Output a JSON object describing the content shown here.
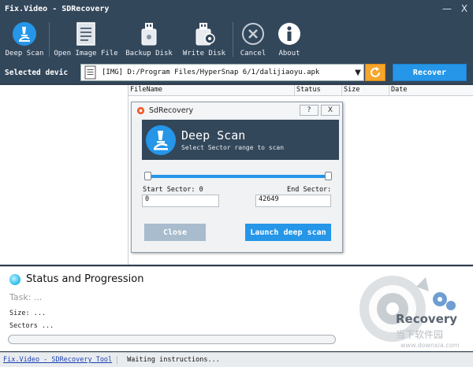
{
  "window": {
    "title": "Fix.Video - SDRecovery",
    "minimize": "—",
    "close": "X"
  },
  "toolbar": {
    "items": [
      {
        "label": "Deep Scan",
        "icon": "microscope-icon"
      },
      {
        "label": "Open Image File",
        "icon": "document-icon"
      },
      {
        "label": "Backup Disk",
        "icon": "usb-drive-icon"
      },
      {
        "label": "Write Disk",
        "icon": "usb-write-icon"
      },
      {
        "label": "Cancel",
        "icon": "cancel-circle-icon"
      },
      {
        "label": "About",
        "icon": "info-icon"
      }
    ]
  },
  "device": {
    "label": "Selected devic",
    "path": "[IMG] D:/Program Files/HyperSnap 6/1/dalijiaoyu.apk",
    "dropdown_glyph": "▼",
    "recover_label": "Recover"
  },
  "file_table": {
    "columns": [
      "FileName",
      "Status",
      "Size",
      "Date"
    ]
  },
  "dialog": {
    "title": "SdRecovery",
    "help": "?",
    "close": "X",
    "heading": "Deep Scan",
    "subheading": "Select Sector range to scan",
    "start_label": "Start Sector: 0",
    "end_label": "End Sector:",
    "start_value": "0",
    "end_value": "42649",
    "range_start_fraction": 0,
    "range_end_fraction": 1,
    "close_button": "Close",
    "launch_button": "Launch deep scan"
  },
  "status": {
    "title": "Status and Progression",
    "task": "Task: ...",
    "size": "Size:   ...",
    "sectors": "Sectors ...",
    "progress_fraction": 0
  },
  "statusbar": {
    "link": "Fix.Video - SDRecovery Tool",
    "message": "Waiting instructions..."
  },
  "watermark": {
    "brand": "Recovery",
    "site": "www.downxia.com",
    "cn": "当下软件园"
  },
  "colors": {
    "header": "#33475b",
    "accent": "#2596e8",
    "refresh": "#f7a52b",
    "close_button": "#a8bccd"
  }
}
